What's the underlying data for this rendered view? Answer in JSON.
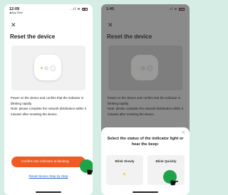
{
  "screen1": {
    "status": {
      "time": "12:09",
      "carrier": "◀ App Store",
      "signal": "..ıl",
      "wifi": "wifi"
    },
    "close_icon": "✕",
    "title": "Reset the device",
    "description": "Power on the device and confirm that the indicator is blinking rapidly.\nNote: please complete the network distribution within 3 minutes after resetting the device.",
    "confirm_button": "Confirm the indicator is blinking",
    "reset_link": "Reset Device Step by Step"
  },
  "screen2": {
    "status": {
      "time": "1:45",
      "signal": "..ıl"
    },
    "close_icon": "✕",
    "title": "Reset the device",
    "description": "Power on the device and confirm that the indicator is blinking rapidly.\nNote: please complete the network distribution within 3 minutes after resetting the device.",
    "sheet": {
      "close_icon": "✕",
      "title": "Select the status of the indicator light or hear the beep:",
      "options": [
        {
          "label": "Blink Slowly"
        },
        {
          "label": "Blink Quickly"
        }
      ]
    }
  },
  "colors": {
    "accent": "#f05a24",
    "link": "#2b63c8",
    "tap": "#1fa34a",
    "background": "#d6ede6"
  }
}
